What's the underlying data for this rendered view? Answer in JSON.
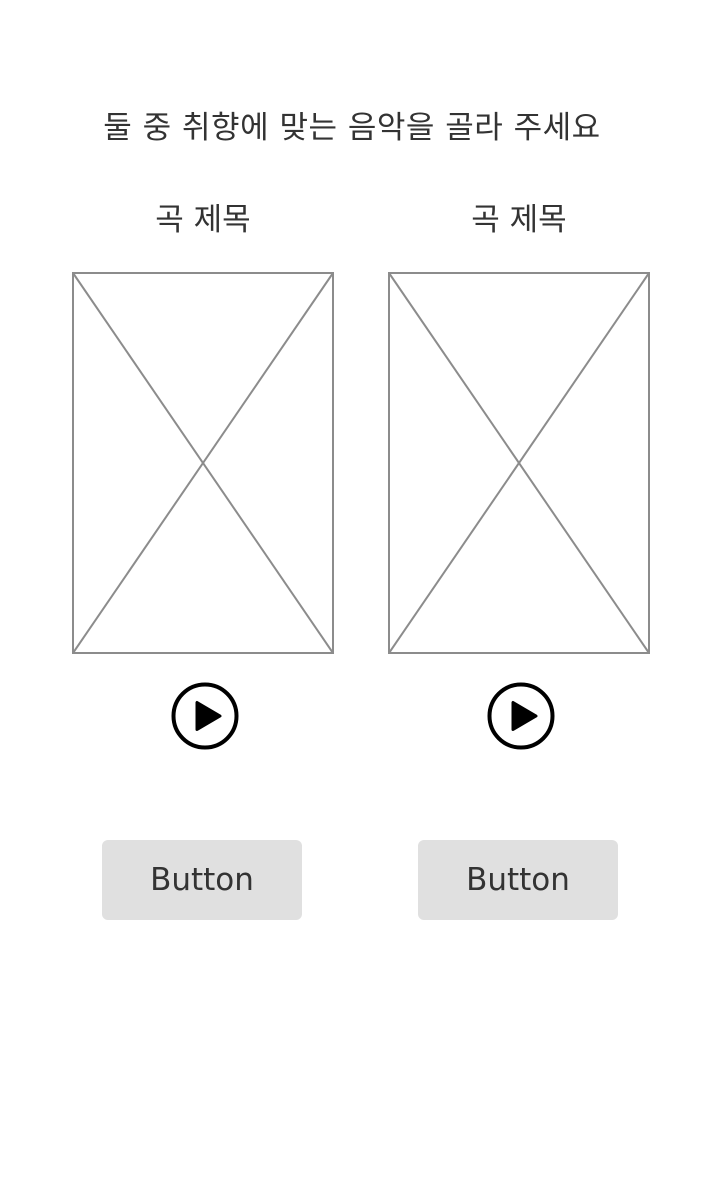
{
  "header": {
    "prompt": "둘 중 취향에 맞는 음악을 골라 주세요"
  },
  "options": [
    {
      "song_title": "곡 제목",
      "artwork_icon": "image-placeholder-icon",
      "play_icon": "play-circle-icon",
      "button_label": "Button"
    },
    {
      "song_title": "곡 제목",
      "artwork_icon": "image-placeholder-icon",
      "play_icon": "play-circle-icon",
      "button_label": "Button"
    }
  ],
  "colors": {
    "text": "#333333",
    "placeholder_stroke": "#8c8c8c",
    "button_background": "#e0e0e0",
    "icon": "#000000",
    "background": "#ffffff"
  }
}
